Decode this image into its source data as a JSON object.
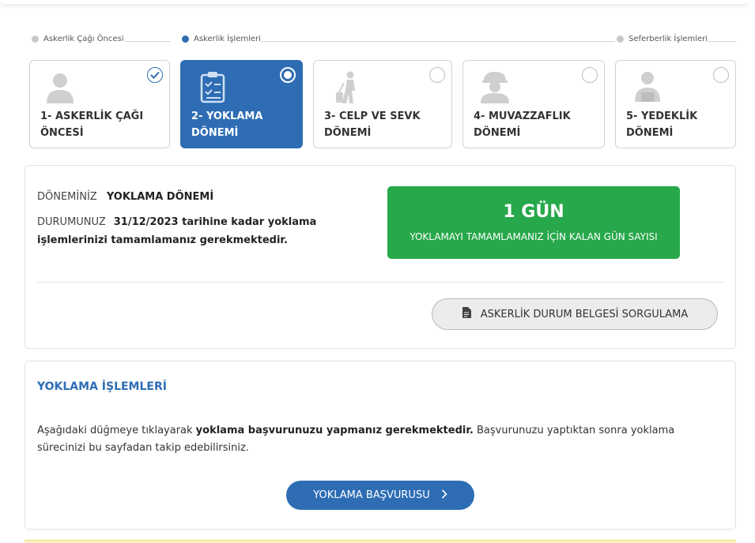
{
  "progress": {
    "steps": [
      {
        "label": "Askerlik Çağı Öncesi",
        "active": false
      },
      {
        "label": "Askerlik İşlemleri",
        "active": true
      },
      {
        "label": "Seferberlik İşlemleri",
        "active": false
      }
    ]
  },
  "cards": [
    {
      "line1": "1- ASKERLİK ÇAĞI",
      "line2": "ÖNCESİ",
      "state": "completed",
      "icon": "person-silhouette-icon"
    },
    {
      "line1": "2- YOKLAMA",
      "line2": "DÖNEMİ",
      "state": "current",
      "icon": "clipboard-checklist-icon"
    },
    {
      "line1": "3- CELP VE SEVK",
      "line2": "DÖNEMİ",
      "state": "pending",
      "icon": "traveler-luggage-icon"
    },
    {
      "line1": "4- MUVAZZAFLIK",
      "line2": "DÖNEMİ",
      "state": "pending",
      "icon": "soldier-helmet-icon"
    },
    {
      "line1": "5- YEDEKLİK",
      "line2": "DÖNEMİ",
      "state": "pending",
      "icon": "reservist-person-icon"
    }
  ],
  "info": {
    "period_label": "DÖNEMİNİZ",
    "period_value": "YOKLAMA DÖNEMİ",
    "status_label": "DURUMUNUZ",
    "status_value": "31/12/2023 tarihine kadar yoklama işlemlerinizi tamamlamanız gerekmektedir.",
    "countdown": "1 GÜN",
    "countdown_caption": "YOKLAMAYI TAMAMLAMANIZ İÇİN KALAN GÜN SAYISI",
    "query_button": "ASKERLİK DURUM BELGESİ SORGULAMA"
  },
  "yoklama": {
    "title": "YOKLAMA İŞLEMLERİ",
    "desc_part1": "Aşağıdaki düğmeye tıklayarak ",
    "desc_bold": "yoklama başvurunuzu yapmanız gerekmektedir.",
    "desc_part2": " Başvurunuzu yaptıktan sonra yoklama sürecinizi bu sayfadan takip edebilirsiniz.",
    "apply_button": "YOKLAMA BAŞVURUSU"
  },
  "colors": {
    "primary": "#2e6db4",
    "success": "#27a84a",
    "border": "#d3d3d3"
  }
}
